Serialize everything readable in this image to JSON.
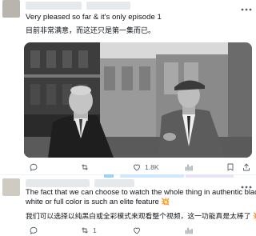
{
  "post1": {
    "text_en": "Very pleased so far & it's only episode 1",
    "text_zh": "目前非常满意，而这还只是第一集而已。",
    "actions": {
      "replies": "",
      "retweets": "",
      "likes": "1.8K",
      "views": "",
      "bookmark": "",
      "share": ""
    }
  },
  "post2": {
    "text_en_line1": "The fact that we can choose to watch the whole thing in authentic black &",
    "text_en_line2": "white or full color is such an elite feature",
    "emoji_en": "💥",
    "text_zh": "我们可以选择以纯黑白或全彩模式来观看整个视频，这一功能真是太棒了",
    "emoji_zh": "💥",
    "actions": {
      "replies": "",
      "retweets": "1",
      "likes": "",
      "views": ""
    }
  },
  "colors": {
    "action_gray": "#536471",
    "like_red": "#f91880",
    "accent_blue": "#1d9bf0"
  }
}
